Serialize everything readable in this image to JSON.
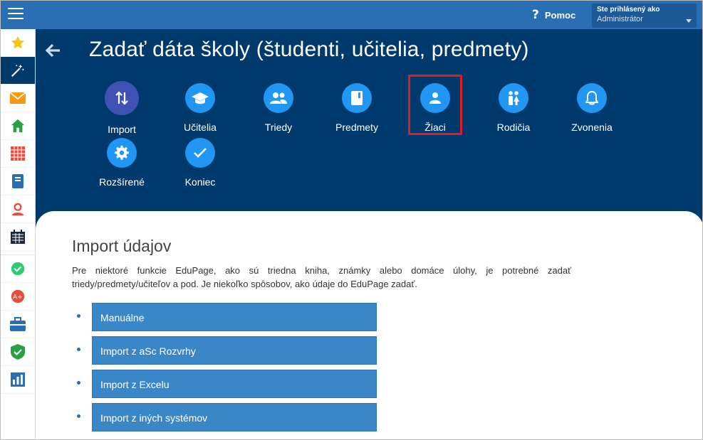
{
  "topbar": {
    "help_label": "Pomoc",
    "user_line1": "Ste prihlásený ako",
    "user_line2": "Administrátor"
  },
  "sidebar": {
    "items": [
      {
        "icon": "star-icon",
        "color": "#f5c518"
      },
      {
        "icon": "magic-wand-icon",
        "color": "#ffffff",
        "active": true
      },
      {
        "icon": "envelope-icon",
        "color": "#f39c12"
      },
      {
        "icon": "home-icon",
        "color": "#27a046"
      },
      {
        "icon": "calendar-grid-icon",
        "color": "#e74c3c"
      },
      {
        "icon": "notebook-icon",
        "color": "#2a6fb3"
      },
      {
        "icon": "user-support-icon",
        "color": "#e74c3c"
      },
      {
        "icon": "timetable-icon",
        "color": "#1e2a3a"
      },
      {
        "icon": "checkmark-icon",
        "color": "#2ecc71"
      },
      {
        "icon": "grade-icon",
        "color": "#e74c3c"
      },
      {
        "icon": "briefcase-icon",
        "color": "#2a6fb3"
      },
      {
        "icon": "shield-check-icon",
        "color": "#27a046"
      },
      {
        "icon": "bar-chart-icon",
        "color": "#2a6fb3"
      }
    ]
  },
  "header": {
    "title": "Zadať dáta školy (študenti, učitelia, predmety)"
  },
  "wizard": {
    "items": [
      {
        "label": "Import",
        "icon": "import-arrows-icon"
      },
      {
        "label": "Učitelia",
        "icon": "graduation-cap-icon"
      },
      {
        "label": "Triedy",
        "icon": "people-icon"
      },
      {
        "label": "Predmety",
        "icon": "book-icon"
      },
      {
        "label": "Žiaci",
        "icon": "person-icon"
      },
      {
        "label": "Rodičia",
        "icon": "parents-icon"
      },
      {
        "label": "Zvonenia",
        "icon": "bell-icon"
      },
      {
        "label": "Rozšírené",
        "icon": "gear-icon"
      },
      {
        "label": "Koniec",
        "icon": "check-icon"
      }
    ]
  },
  "content": {
    "title": "Import údajov",
    "description": "Pre niektoré funkcie EduPage, ako sú triedna kniha, známky alebo domáce úlohy, je potrebné zadať triedy/predmety/učiteľov a pod. Je niekoľko spôsobov, ako údaje do EduPage zadať.",
    "options": [
      "Manuálne",
      "Import z aSc Rozvrhy",
      "Import z Excelu",
      "Import z iných systémov"
    ]
  },
  "colors": {
    "topbar": "#2a6fb3",
    "header_bg": "#003a6c",
    "wizard_circle": "#2196f3",
    "import_circle": "#3f51b5",
    "highlight": "#e01b24",
    "option_button": "#3a87c8"
  }
}
